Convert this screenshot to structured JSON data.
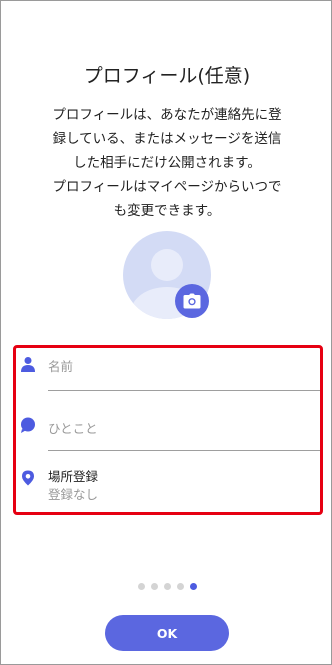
{
  "header": {
    "title": "プロフィール(任意)"
  },
  "description": "プロフィールは、あなたが連絡先に登\n録している、またはメッセージを送信\nした相手にだけ公開されます。\nプロフィールはマイページからいつで\nも変更できます。",
  "avatar": {
    "icon": "person-icon",
    "camera_icon": "camera-icon"
  },
  "form": {
    "name_placeholder": "名前",
    "comment_placeholder": "ひとこと",
    "location_label": "場所登録",
    "location_value": "登録なし"
  },
  "pager": {
    "total": 5,
    "active_index": 4
  },
  "buttons": {
    "ok_label": "OK"
  },
  "colors": {
    "accent": "#5b67e0",
    "highlight_border": "#e60012"
  }
}
